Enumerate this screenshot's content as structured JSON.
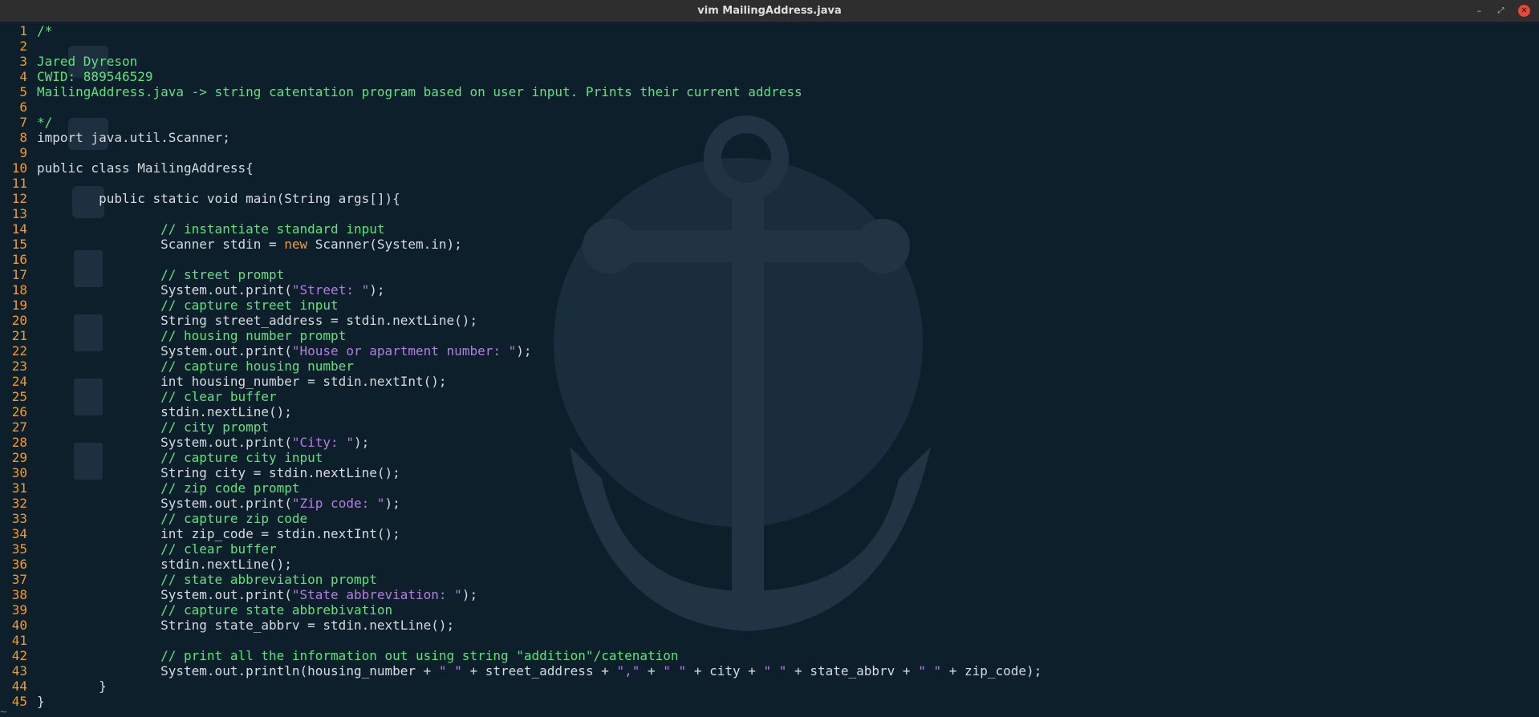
{
  "window": {
    "title": "vim MailingAddress.java",
    "minimize_glyph": "–",
    "maximize_glyph": "⤢",
    "close_glyph": "✕"
  },
  "colors": {
    "background": "#0e1f2c",
    "line_number": "#f39a2e",
    "comment": "#5fe27e",
    "keyword": "#ff9a2a",
    "string": "#b27fe0",
    "text": "#d5dbe1"
  },
  "editor": {
    "lines": [
      {
        "n": "1",
        "segs": [
          {
            "t": "/*",
            "c": "cmt"
          }
        ]
      },
      {
        "n": "2",
        "segs": []
      },
      {
        "n": "3",
        "segs": [
          {
            "t": "Jared Dyreson",
            "c": "cmt"
          }
        ]
      },
      {
        "n": "4",
        "segs": [
          {
            "t": "CWID: 889546529",
            "c": "cmt"
          }
        ]
      },
      {
        "n": "5",
        "segs": [
          {
            "t": "MailingAddress.java -> string catentation program based on user input. Prints their current address",
            "c": "cmt"
          }
        ]
      },
      {
        "n": "6",
        "segs": []
      },
      {
        "n": "7",
        "segs": [
          {
            "t": "*/",
            "c": "cmt"
          }
        ]
      },
      {
        "n": "8",
        "segs": [
          {
            "t": "import java.util.Scanner;",
            "c": "typ"
          }
        ]
      },
      {
        "n": "9",
        "segs": []
      },
      {
        "n": "10",
        "segs": [
          {
            "t": "public class MailingAddress{",
            "c": "typ"
          }
        ]
      },
      {
        "n": "11",
        "segs": []
      },
      {
        "n": "12",
        "segs": [
          {
            "t": "        public static void main(String args[]){",
            "c": "typ"
          }
        ]
      },
      {
        "n": "13",
        "segs": []
      },
      {
        "n": "14",
        "segs": [
          {
            "t": "                ",
            "c": "typ"
          },
          {
            "t": "// instantiate standard input",
            "c": "cmt"
          }
        ]
      },
      {
        "n": "15",
        "segs": [
          {
            "t": "                Scanner stdin = ",
            "c": "typ"
          },
          {
            "t": "new",
            "c": "kw"
          },
          {
            "t": " Scanner(System.in);",
            "c": "typ"
          }
        ]
      },
      {
        "n": "16",
        "segs": []
      },
      {
        "n": "17",
        "segs": [
          {
            "t": "                ",
            "c": "typ"
          },
          {
            "t": "// street prompt",
            "c": "cmt"
          }
        ]
      },
      {
        "n": "18",
        "segs": [
          {
            "t": "                System.out.print(",
            "c": "typ"
          },
          {
            "t": "\"Street: \"",
            "c": "str"
          },
          {
            "t": ");",
            "c": "typ"
          }
        ]
      },
      {
        "n": "19",
        "segs": [
          {
            "t": "                ",
            "c": "typ"
          },
          {
            "t": "// capture street input",
            "c": "cmt"
          }
        ]
      },
      {
        "n": "20",
        "segs": [
          {
            "t": "                String street_address = stdin.nextLine();",
            "c": "typ"
          }
        ]
      },
      {
        "n": "21",
        "segs": [
          {
            "t": "                ",
            "c": "typ"
          },
          {
            "t": "// housing number prompt",
            "c": "cmt"
          }
        ]
      },
      {
        "n": "22",
        "segs": [
          {
            "t": "                System.out.print(",
            "c": "typ"
          },
          {
            "t": "\"House or apartment number: \"",
            "c": "str"
          },
          {
            "t": ");",
            "c": "typ"
          }
        ]
      },
      {
        "n": "23",
        "segs": [
          {
            "t": "                ",
            "c": "typ"
          },
          {
            "t": "// capture housing number",
            "c": "cmt"
          }
        ]
      },
      {
        "n": "24",
        "segs": [
          {
            "t": "                int housing_number = stdin.nextInt();",
            "c": "typ"
          }
        ]
      },
      {
        "n": "25",
        "segs": [
          {
            "t": "                ",
            "c": "typ"
          },
          {
            "t": "// clear buffer",
            "c": "cmt"
          }
        ]
      },
      {
        "n": "26",
        "segs": [
          {
            "t": "                stdin.nextLine();",
            "c": "typ"
          }
        ]
      },
      {
        "n": "27",
        "segs": [
          {
            "t": "                ",
            "c": "typ"
          },
          {
            "t": "// city prompt",
            "c": "cmt"
          }
        ]
      },
      {
        "n": "28",
        "segs": [
          {
            "t": "                System.out.print(",
            "c": "typ"
          },
          {
            "t": "\"City: \"",
            "c": "str"
          },
          {
            "t": ");",
            "c": "typ"
          }
        ]
      },
      {
        "n": "29",
        "segs": [
          {
            "t": "                ",
            "c": "typ"
          },
          {
            "t": "// capture city input",
            "c": "cmt"
          }
        ]
      },
      {
        "n": "30",
        "segs": [
          {
            "t": "                String city = stdin.nextLine();",
            "c": "typ"
          }
        ]
      },
      {
        "n": "31",
        "segs": [
          {
            "t": "                ",
            "c": "typ"
          },
          {
            "t": "// zip code prompt",
            "c": "cmt"
          }
        ]
      },
      {
        "n": "32",
        "segs": [
          {
            "t": "                System.out.print(",
            "c": "typ"
          },
          {
            "t": "\"Zip code: \"",
            "c": "str"
          },
          {
            "t": ");",
            "c": "typ"
          }
        ]
      },
      {
        "n": "33",
        "segs": [
          {
            "t": "                ",
            "c": "typ"
          },
          {
            "t": "// capture zip code",
            "c": "cmt"
          }
        ]
      },
      {
        "n": "34",
        "segs": [
          {
            "t": "                int zip_code = stdin.nextInt();",
            "c": "typ"
          }
        ]
      },
      {
        "n": "35",
        "segs": [
          {
            "t": "                ",
            "c": "typ"
          },
          {
            "t": "// clear buffer",
            "c": "cmt"
          }
        ]
      },
      {
        "n": "36",
        "segs": [
          {
            "t": "                stdin.nextLine();",
            "c": "typ"
          }
        ]
      },
      {
        "n": "37",
        "segs": [
          {
            "t": "                ",
            "c": "typ"
          },
          {
            "t": "// state abbreviation prompt",
            "c": "cmt"
          }
        ]
      },
      {
        "n": "38",
        "segs": [
          {
            "t": "                System.out.print(",
            "c": "typ"
          },
          {
            "t": "\"State abbreviation: \"",
            "c": "str"
          },
          {
            "t": ");",
            "c": "typ"
          }
        ]
      },
      {
        "n": "39",
        "segs": [
          {
            "t": "                ",
            "c": "typ"
          },
          {
            "t": "// capture state abbrebivation",
            "c": "cmt"
          }
        ]
      },
      {
        "n": "40",
        "segs": [
          {
            "t": "                String state_abbrv = stdin.nextLine();",
            "c": "typ"
          }
        ]
      },
      {
        "n": "41",
        "segs": []
      },
      {
        "n": "42",
        "segs": [
          {
            "t": "                ",
            "c": "typ"
          },
          {
            "t": "// print all the information out using string \"addition\"/catenation",
            "c": "cmt"
          }
        ]
      },
      {
        "n": "43",
        "segs": [
          {
            "t": "                System.out.println(housing_number + ",
            "c": "typ"
          },
          {
            "t": "\" \"",
            "c": "str"
          },
          {
            "t": " + street_address + ",
            "c": "typ"
          },
          {
            "t": "\",\"",
            "c": "str"
          },
          {
            "t": " + ",
            "c": "typ"
          },
          {
            "t": "\" \"",
            "c": "str"
          },
          {
            "t": " + city + ",
            "c": "typ"
          },
          {
            "t": "\" \"",
            "c": "str"
          },
          {
            "t": " + state_abbrv + ",
            "c": "typ"
          },
          {
            "t": "\" \"",
            "c": "str"
          },
          {
            "t": " + zip_code);",
            "c": "typ"
          }
        ]
      },
      {
        "n": "44",
        "segs": [
          {
            "t": "        }",
            "c": "typ"
          }
        ]
      },
      {
        "n": "45",
        "segs": [
          {
            "t": "}",
            "c": "typ"
          }
        ]
      }
    ],
    "tilde": "~"
  }
}
